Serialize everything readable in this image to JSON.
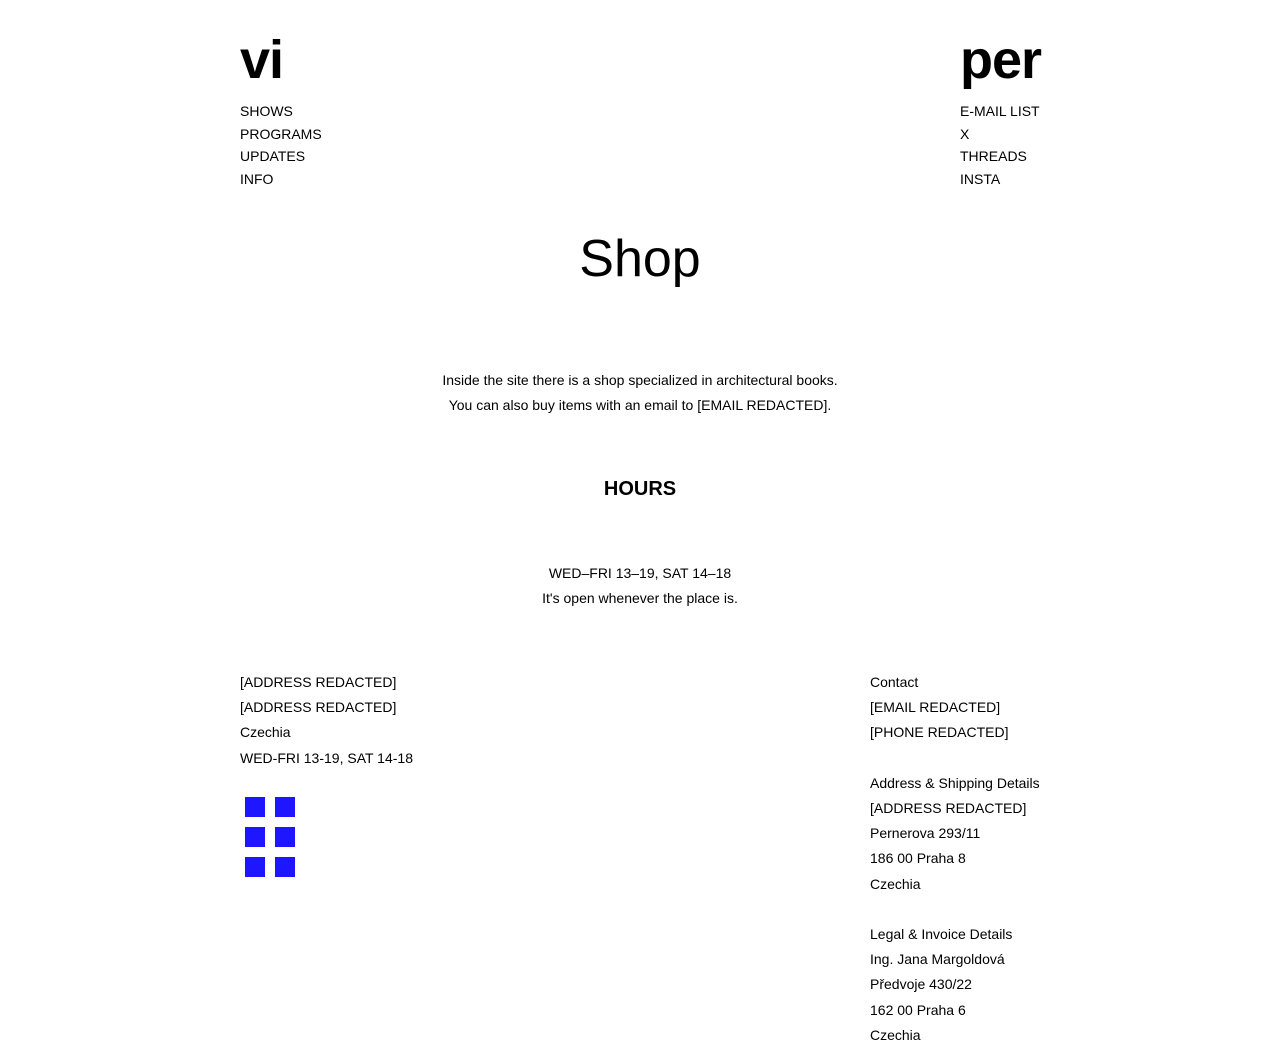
{
  "header": {
    "logo_left": "vi",
    "logo_right": "per",
    "nav_left": [
      "SHOWS",
      "PROGRAMS",
      "UPDATES",
      "INFO"
    ],
    "nav_right": [
      "E-MAIL LIST",
      "X",
      "THREADS",
      "INSTA"
    ]
  },
  "main": {
    "title": "Shop",
    "intro": [
      "Inside the site there is a shop specialized in architectural books.",
      "You can also buy items with an email to [EMAIL REDACTED]."
    ],
    "hours_heading": "HOURS",
    "hours": [
      "WED–FRI 13–19, SAT 14–18",
      "It's open whenever the place is."
    ]
  },
  "footer": {
    "left": [
      "[ADDRESS REDACTED]",
      "[ADDRESS REDACTED]",
      "Czechia",
      "WED-FRI 13-19, SAT 14-18"
    ],
    "contact": {
      "heading": "Contact",
      "email": "[EMAIL REDACTED]",
      "phone": "[PHONE REDACTED]"
    },
    "shipping": {
      "heading": "Address & Shipping Details",
      "lines": [
        "[ADDRESS REDACTED]",
        "Pernerova 293/11",
        "186 00 Praha 8",
        "Czechia"
      ]
    },
    "legal": {
      "heading": "Legal & Invoice Details",
      "lines": [
        "Ing. Jana Margoldová",
        "Předvoje 430/22",
        "162 00 Praha 6",
        "Czechia"
      ]
    },
    "grid_icon": {
      "name": "grid-icon",
      "color": "#1e16ff"
    }
  }
}
